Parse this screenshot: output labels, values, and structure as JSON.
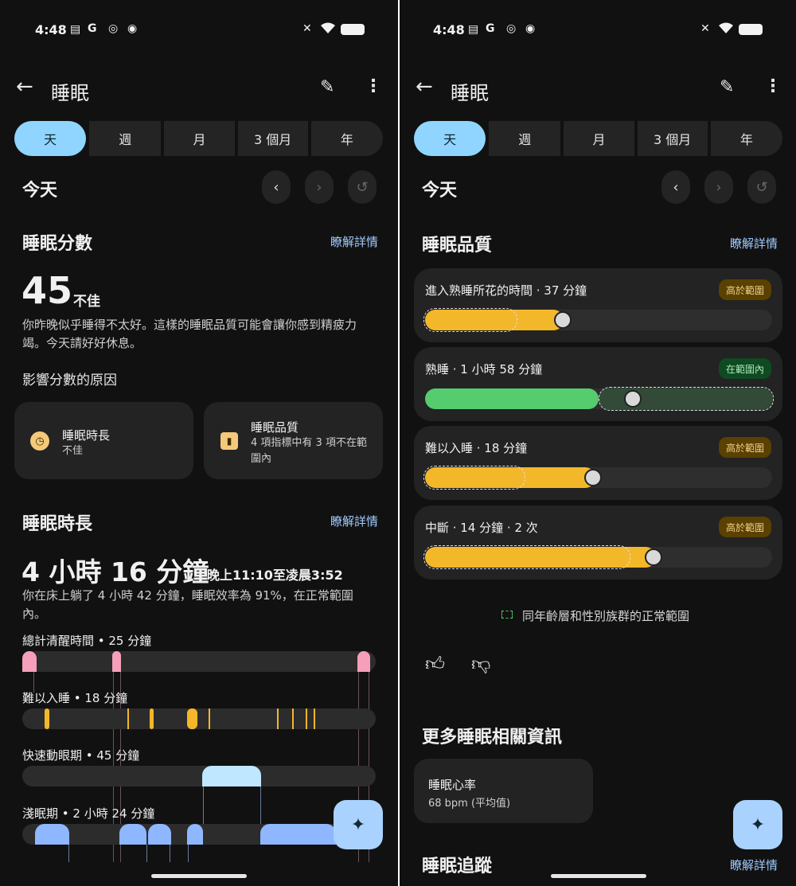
{
  "status": {
    "time": "4:48",
    "icons": [
      "calendar-icon",
      "google-icon",
      "watch-icon",
      "record-icon"
    ],
    "right_icons": [
      "mute-icon",
      "wifi-icon",
      "battery-icon"
    ]
  },
  "header": {
    "title": "睡眠"
  },
  "tabs": [
    "天",
    "週",
    "月",
    "3 個月",
    "年"
  ],
  "period": {
    "label": "今天"
  },
  "left": {
    "score": {
      "heading": "睡眠分數",
      "link": "瞭解詳情",
      "value": "45",
      "rating": "不佳",
      "desc_line1": "你昨晚似乎睡得不太好。這樣的睡眠品質可能會讓你感到精疲力",
      "desc_line2": "竭。今天請好好休息。",
      "factors_heading": "影響分數的原因",
      "factors": [
        {
          "icon": "clock-icon",
          "title": "睡眠時長",
          "sub1": "不佳",
          "sub2": ""
        },
        {
          "icon": "chart-icon",
          "title": "睡眠品質",
          "sub1": "4 項指標中有 3 項不在範",
          "sub2": "圍內"
        }
      ]
    },
    "duration": {
      "heading": "睡眠時長",
      "link": "瞭解詳情",
      "value": "4 小時 16 分鐘",
      "range": "晚上11:10至凌晨3:52",
      "desc_line1": "你在床上躺了 4 小時 42 分鐘，睡眠效率為 91%，在正常範圍",
      "desc_line2": "內。",
      "stages": [
        {
          "label": "總計清醒時間 • 25 分鐘",
          "color": "#f59fba"
        },
        {
          "label": "難以入睡 • 18 分鐘",
          "color": "#f3b72a"
        },
        {
          "label": "快速動眼期 • 45 分鐘",
          "color": "#bfe7ff"
        },
        {
          "label": "淺眠期 • 2 小時 24 分鐘",
          "color": "#8eb7ff"
        }
      ]
    }
  },
  "right": {
    "quality": {
      "heading": "睡眠品質",
      "link": "瞭解詳情",
      "metrics": [
        {
          "label": "進入熟睡所花的時間 · 37 分鐘",
          "badge": "高於範圍",
          "badge_kind": "high",
          "fill_color": "#f3b72a",
          "value_fraction": 0.4,
          "range_fraction": [
            0.0,
            0.27
          ]
        },
        {
          "label": "熟睡 · 1 小時 58 分鐘",
          "badge": "在範圍內",
          "badge_kind": "in",
          "fill_color": "#55cc6e",
          "value_fraction": 0.59,
          "range_fraction": [
            0.5,
            1.0
          ]
        },
        {
          "label": "難以入睡 · 18 分鐘",
          "badge": "高於範圍",
          "badge_kind": "high",
          "fill_color": "#f3b72a",
          "value_fraction": 0.49,
          "range_fraction": [
            0.0,
            0.29
          ]
        },
        {
          "label": "中斷 · 14 分鐘 · 2 次",
          "badge": "高於範圍",
          "badge_kind": "high",
          "fill_color": "#f3b72a",
          "value_fraction": 0.66,
          "range_fraction": [
            0.0,
            0.59
          ]
        }
      ],
      "legend": "同年齡層和性別族群的正常範圍"
    },
    "feedback": {
      "up": "thumbs-up-icon",
      "down": "thumbs-down-icon"
    },
    "more": {
      "heading": "更多睡眠相關資訊",
      "card_title": "睡眠心率",
      "card_sub": "68 bpm (平均值)",
      "next_heading": "睡眠追蹤",
      "next_link": "瞭解詳情"
    }
  },
  "colors": {
    "accent": "#8fd5ff",
    "link": "#9ecbff",
    "background": "#111111",
    "card": "#232323"
  }
}
